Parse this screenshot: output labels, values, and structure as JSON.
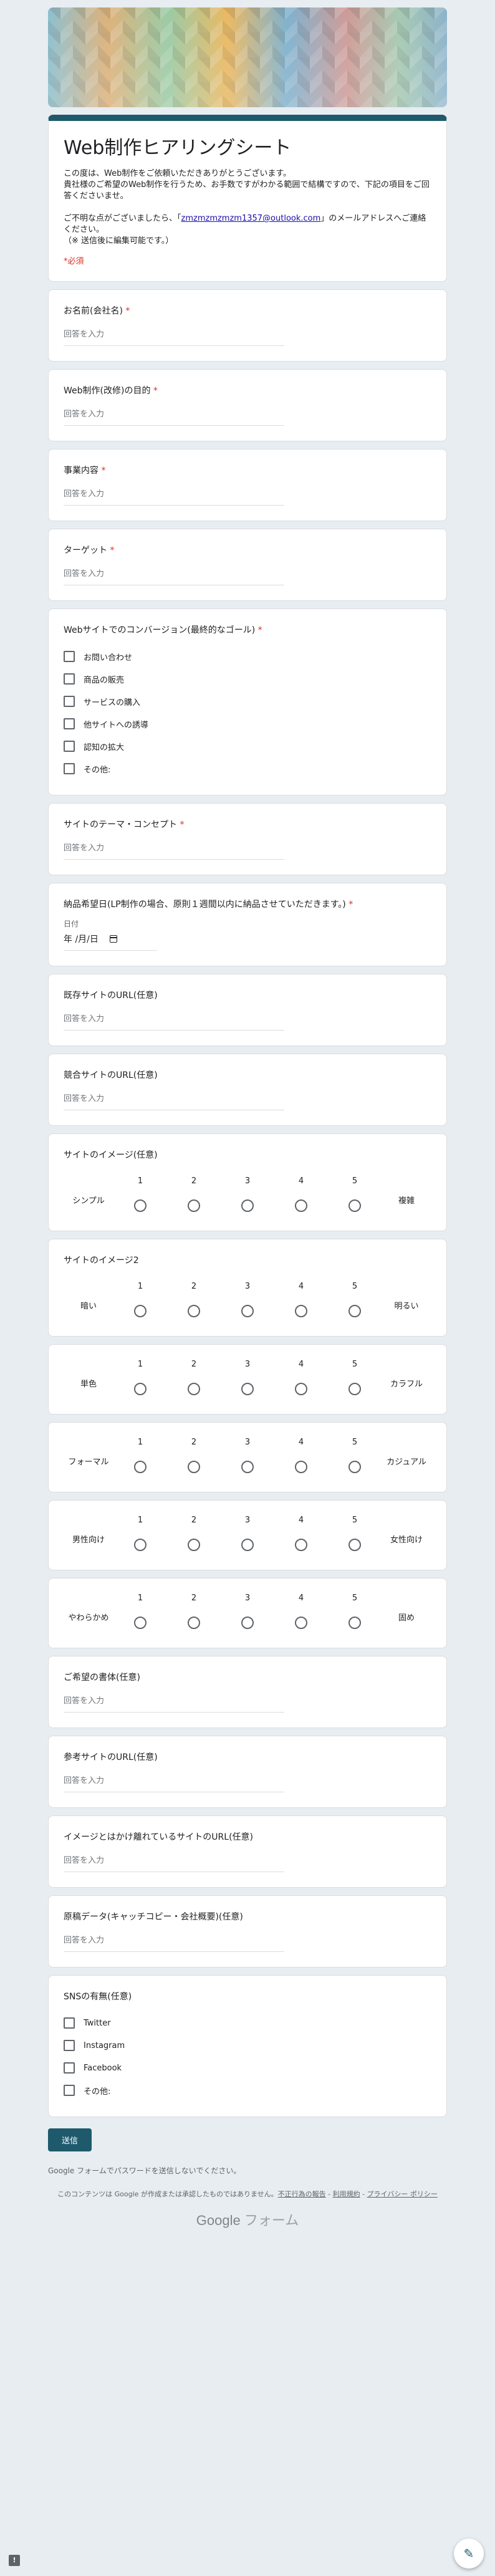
{
  "form": {
    "title": "Web制作ヒアリングシート",
    "description_lines": [
      "この度は、Web制作をご依頼いただきありがとうございます。",
      "貴社様のご希望のWeb制作を行うため、お手数ですがわかる範囲で結構ですので、下記の項目をご回答くださいませ。",
      "",
      "ご不明な点がございましたら、「zmzmzmzmzm1357@outlook.com」のメールアドレスへご連絡ください。",
      "（※ 送信後に編集可能です。）"
    ],
    "desc_email_prefix": "ご不明な点がございましたら、「",
    "desc_email": "zmzmzmzmzm1357@outlook.com",
    "desc_email_suffix": "」のメールアドレスへご連絡ください。",
    "desc_note": "（※ 送信後に編集可能です。）",
    "required_note": "*必須"
  },
  "placeholder": "回答を入力",
  "questions": {
    "q1": {
      "title": "お名前(会社名)",
      "required": "*"
    },
    "q2": {
      "title": "Web制作(改修)の目的",
      "required": "*"
    },
    "q3": {
      "title": "事業内容",
      "required": "*"
    },
    "q4": {
      "title": "ターゲット",
      "required": "*"
    },
    "q5": {
      "title": "Webサイトでのコンバージョン(最終的なゴール)",
      "required": "*",
      "options": [
        "お問い合わせ",
        "商品の販売",
        "サービスの購入",
        "他サイトへの誘導",
        "認知の拡大",
        "その他:"
      ]
    },
    "q6": {
      "title": "サイトのテーマ・コンセプト",
      "required": "*"
    },
    "q7": {
      "title": "納品希望日(LP制作の場合、原則１週間以内に納品させていただきます。)",
      "required": "*",
      "date_label": "日付",
      "date_value": "年 /月/日"
    },
    "q8": {
      "title": "既存サイトのURL(任意)"
    },
    "q9": {
      "title": "競合サイトのURL(任意)"
    },
    "q10": {
      "title": "サイトのイメージ(任意)",
      "left": "シンプル",
      "right": "複雑"
    },
    "q11": {
      "title": "サイトのイメージ2",
      "left": "暗い",
      "right": "明るい"
    },
    "q12": {
      "title": "",
      "left": "単色",
      "right": "カラフル"
    },
    "q13": {
      "title": "",
      "left": "フォーマル",
      "right": "カジュアル"
    },
    "q14": {
      "title": "",
      "left": "男性向け",
      "right": "女性向け"
    },
    "q15": {
      "title": "",
      "left": "やわらかめ",
      "right": "固め"
    },
    "q16": {
      "title": "ご希望の書体(任意)"
    },
    "q17": {
      "title": "参考サイトのURL(任意)"
    },
    "q18": {
      "title": "イメージとはかけ離れているサイトのURL(任意)"
    },
    "q19": {
      "title": "原稿データ(キャッチコピー・会社概要)(任意)"
    },
    "q20": {
      "title": "SNSの有無(任意)",
      "options": [
        "Twitter",
        "Instagram",
        "Facebook",
        "その他:"
      ]
    }
  },
  "scale_numbers": [
    "1",
    "2",
    "3",
    "4",
    "5"
  ],
  "footer": {
    "submit_label": "送信",
    "password_note": "Google フォームでパスワードを送信しないでください。",
    "content_note_prefix": "このコンテンツは Google が作成または承認したものではありません。",
    "link_abuse": "不正行為の報告",
    "sep1": " - ",
    "link_terms": "利用規約",
    "sep2": " - ",
    "link_privacy": "プライバシー ポリシー",
    "brand_google": "Google",
    "brand_forms": " フォーム"
  },
  "colors": {
    "accent": "#1e5a6c",
    "required": "#d93025",
    "background": "#e8edf1"
  },
  "icons": {
    "report": "report-icon",
    "edit": "pencil-icon",
    "calendar": "calendar-icon"
  }
}
